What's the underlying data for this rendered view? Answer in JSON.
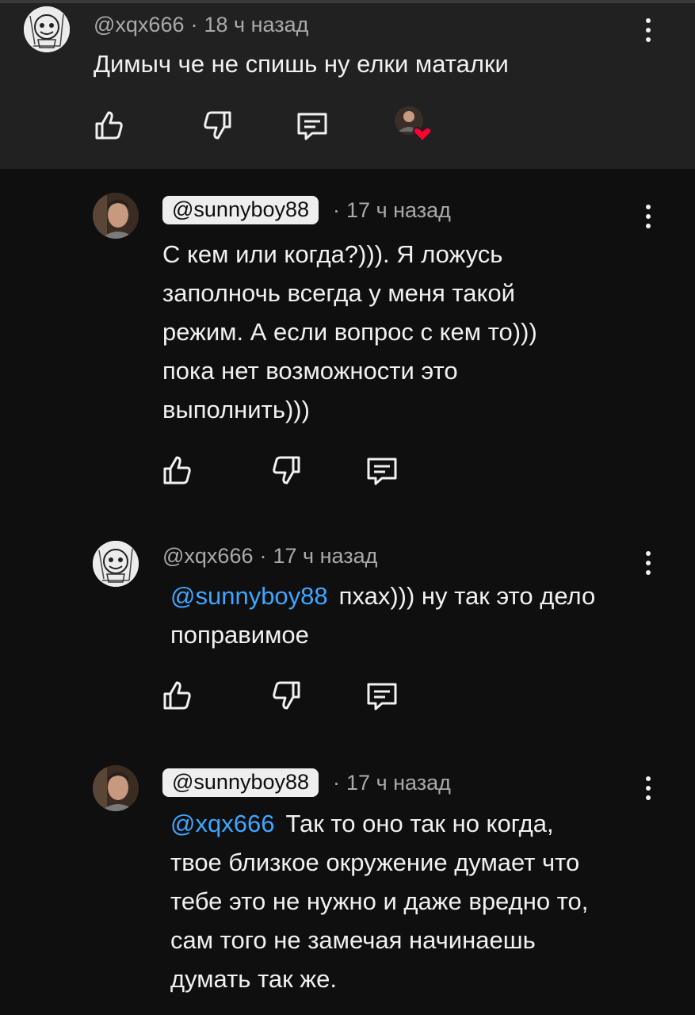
{
  "comments": [
    {
      "author": "@xqx666",
      "time": "18 ч назад",
      "separator": "·",
      "text": "Димыч че не спишь ну елки маталки",
      "avatar_icon": "sketch-avatar"
    },
    {
      "author": "@sunnyboy88",
      "time": "17 ч назад",
      "separator": "·",
      "text": "С кем или когда?))). Я ложусь\nзаполночь всегда у меня такой\nрежим. А если вопрос с кем то)))\nпока нет возможности это\nвыполнить)))",
      "avatar_icon": "photo-avatar"
    },
    {
      "author": "@xqx666",
      "time": "17 ч назад",
      "separator": "·",
      "mention": "@sunnyboy88",
      "text": "пхах))) ну так это дело\nпоправимое",
      "avatar_icon": "sketch-avatar"
    },
    {
      "author": "@sunnyboy88",
      "time": "17 ч назад",
      "separator": "·",
      "mention": "@xqx666",
      "text": "Так то оно так но когда,\nтвое близкое окружение думает что\nтебе это не нужно и даже вредно то,\nсам того не замечая начинаешь\nдумать так же.",
      "avatar_icon": "photo-avatar"
    }
  ],
  "icons": {
    "like": "thumb-up-icon",
    "dislike": "thumb-down-icon",
    "reply": "reply-icon",
    "more": "more-vertical-icon",
    "creator_heart": "creator-heart-icon"
  },
  "colors": {
    "background": "#0f0f0f",
    "parent_background": "#212121",
    "text": "#f1f1f1",
    "meta": "#aaaaaa",
    "mention": "#3ea6ff",
    "heart": "#ff0033"
  }
}
